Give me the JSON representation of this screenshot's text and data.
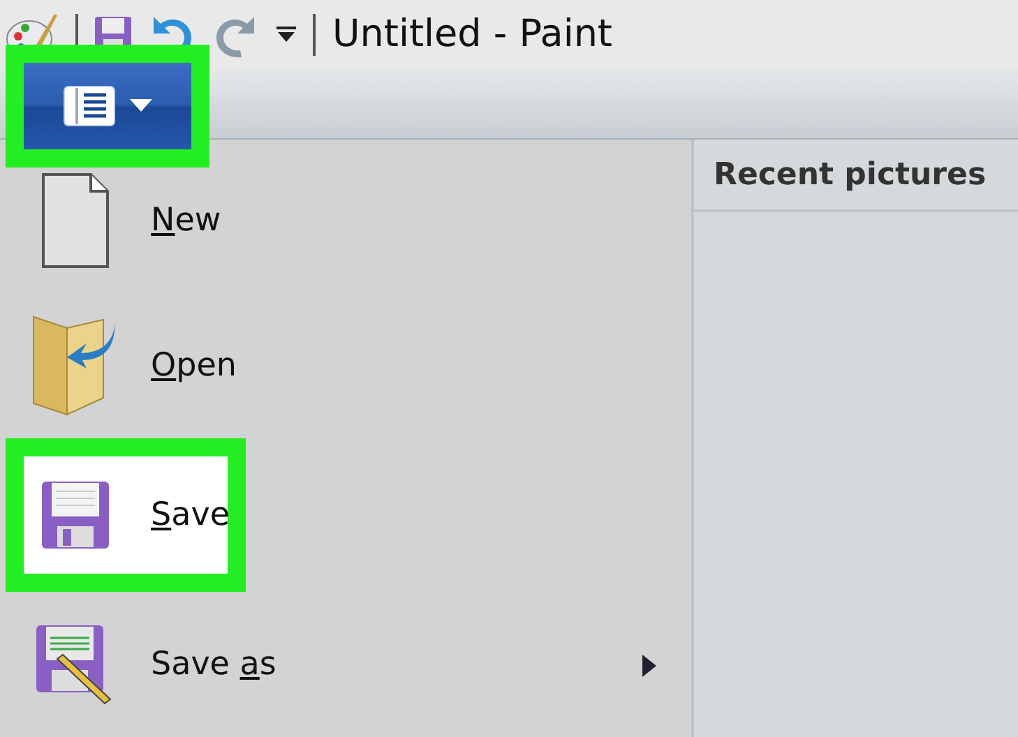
{
  "window": {
    "title": "Untitled - Paint"
  },
  "quick_access": [
    {
      "kind": "save"
    },
    {
      "kind": "undo",
      "disabled": false
    },
    {
      "kind": "redo",
      "disabled": true
    },
    {
      "kind": "customize"
    }
  ],
  "file_button": {
    "highlighted": true
  },
  "menu_items": [
    {
      "kind": "new",
      "access_key": "N",
      "rest": "ew",
      "highlighted": false,
      "submenu": false
    },
    {
      "kind": "open",
      "access_key": "O",
      "rest": "pen",
      "highlighted": false,
      "submenu": false
    },
    {
      "kind": "save",
      "access_key": "S",
      "rest": "ave",
      "highlighted": true,
      "submenu": false
    },
    {
      "kind": "saveas",
      "prefix": "Save ",
      "access_key": "a",
      "rest": "s",
      "highlighted": false,
      "submenu": true
    }
  ],
  "recent": {
    "title": "Recent pictures"
  }
}
